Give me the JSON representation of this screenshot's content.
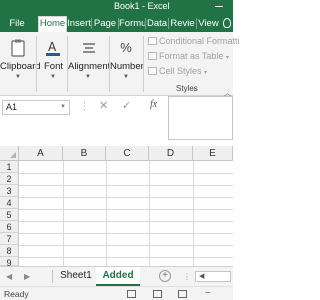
{
  "window": {
    "title": "Book1 - Excel"
  },
  "ribbon_tabs": [
    "File",
    "Home",
    "Insert",
    "Page L",
    "Formu",
    "Data",
    "Revie",
    "View"
  ],
  "active_tab": "Home",
  "ribbon": {
    "clipboard": "Clipboard",
    "font": "Font",
    "alignment": "Alignment",
    "number": "Number",
    "number_icon": "%",
    "conditional": "Conditional Formatti",
    "format_table": "Format as Table",
    "cell_styles": "Cell Styles",
    "styles_group": "Styles"
  },
  "formula_bar": {
    "name_box": "A1",
    "cancel": "✕",
    "enter": "✓",
    "fx": "fx"
  },
  "grid": {
    "columns": [
      "A",
      "B",
      "C",
      "D",
      "E"
    ],
    "rows": [
      "1",
      "2",
      "3",
      "4",
      "5",
      "6",
      "7",
      "8",
      "9"
    ]
  },
  "sheets": {
    "tabs": [
      "Sheet1",
      "Added"
    ],
    "active": "Added"
  },
  "status": {
    "text": "Ready"
  },
  "colors": {
    "brand": "#217346",
    "ribbon_bg": "#f3f3f3"
  }
}
